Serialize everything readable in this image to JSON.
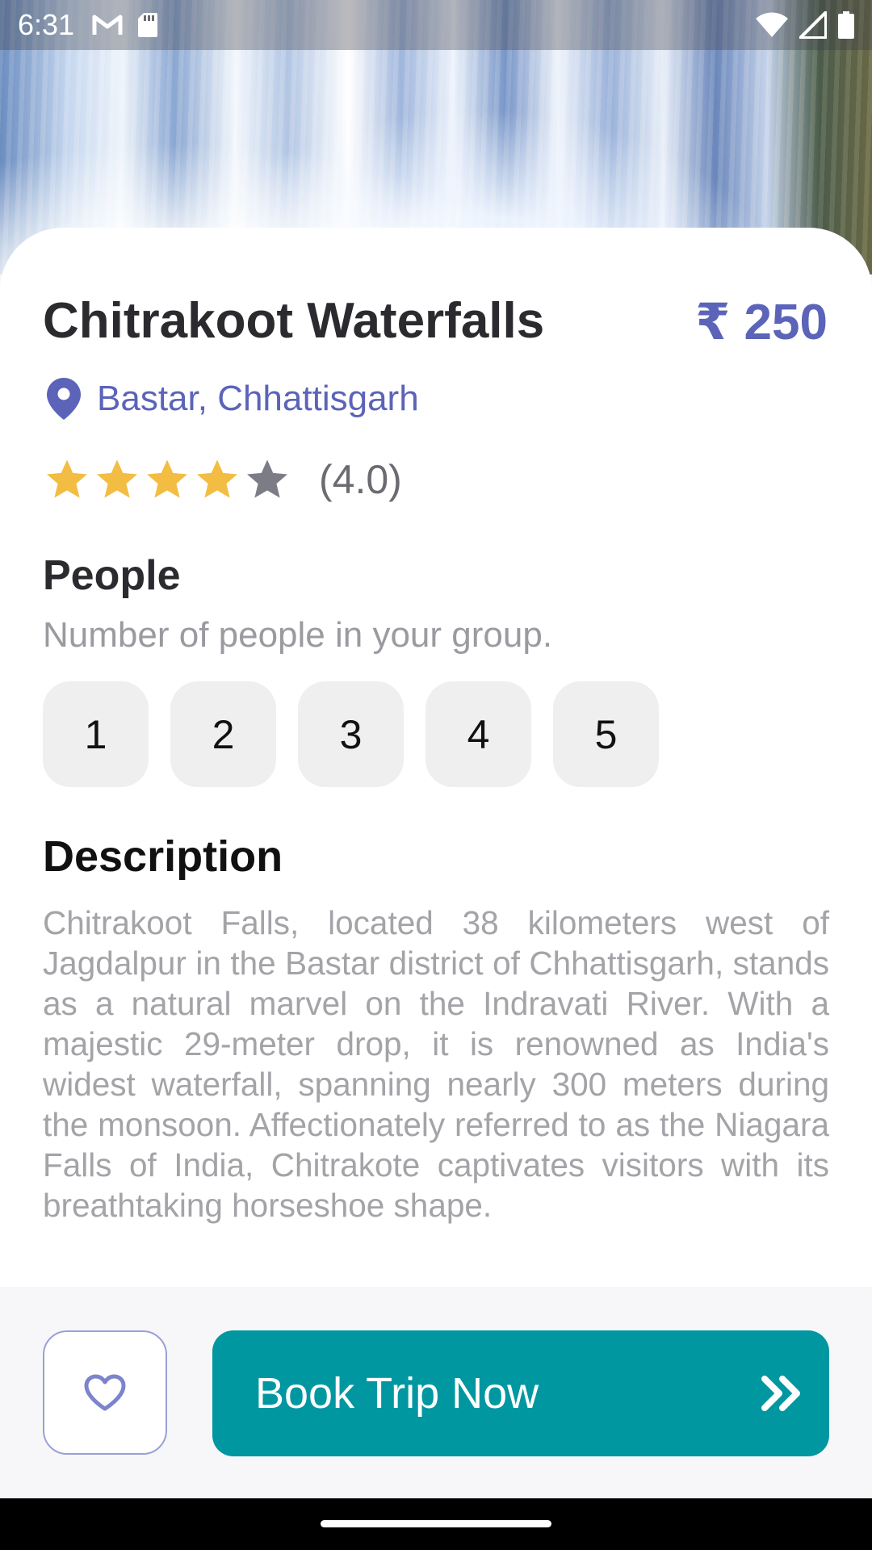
{
  "status_bar": {
    "time": "6:31",
    "left_icons": [
      "gmail-icon",
      "sd-card-icon"
    ],
    "right_icons": [
      "wifi-icon",
      "signal-icon",
      "battery-icon"
    ]
  },
  "place": {
    "title": "Chitrakoot Waterfalls",
    "price": "₹ 250",
    "location": "Bastar, Chhattisgarh",
    "rating_text": "(4.0)",
    "rating_value": 4.0,
    "rating_max": 5
  },
  "people": {
    "heading": "People",
    "subtitle": "Number of people in your group.",
    "options": [
      "1",
      "2",
      "3",
      "4",
      "5"
    ]
  },
  "description": {
    "heading": "Description",
    "text": "Chitrakoot Falls, located 38 kilometers west of Jagdalpur in the Bastar district of Chhattisgarh, stands as a natural marvel on the Indravati River. With a majestic 29-meter drop, it is renowned as India's widest waterfall, spanning nearly 300 meters during the monsoon. Affectionately referred to as the Niagara Falls of India, Chitrakote captivates visitors with its breathtaking horseshoe shape."
  },
  "actions": {
    "favorite_icon": "heart-outline-icon",
    "book_label": "Book Trip Now",
    "book_icon": "double-chevron-right-icon"
  },
  "colors": {
    "accent": "#5b64b8",
    "book_button": "#0097a1",
    "star_filled": "#f2bd42",
    "star_empty": "#7c7c86"
  }
}
